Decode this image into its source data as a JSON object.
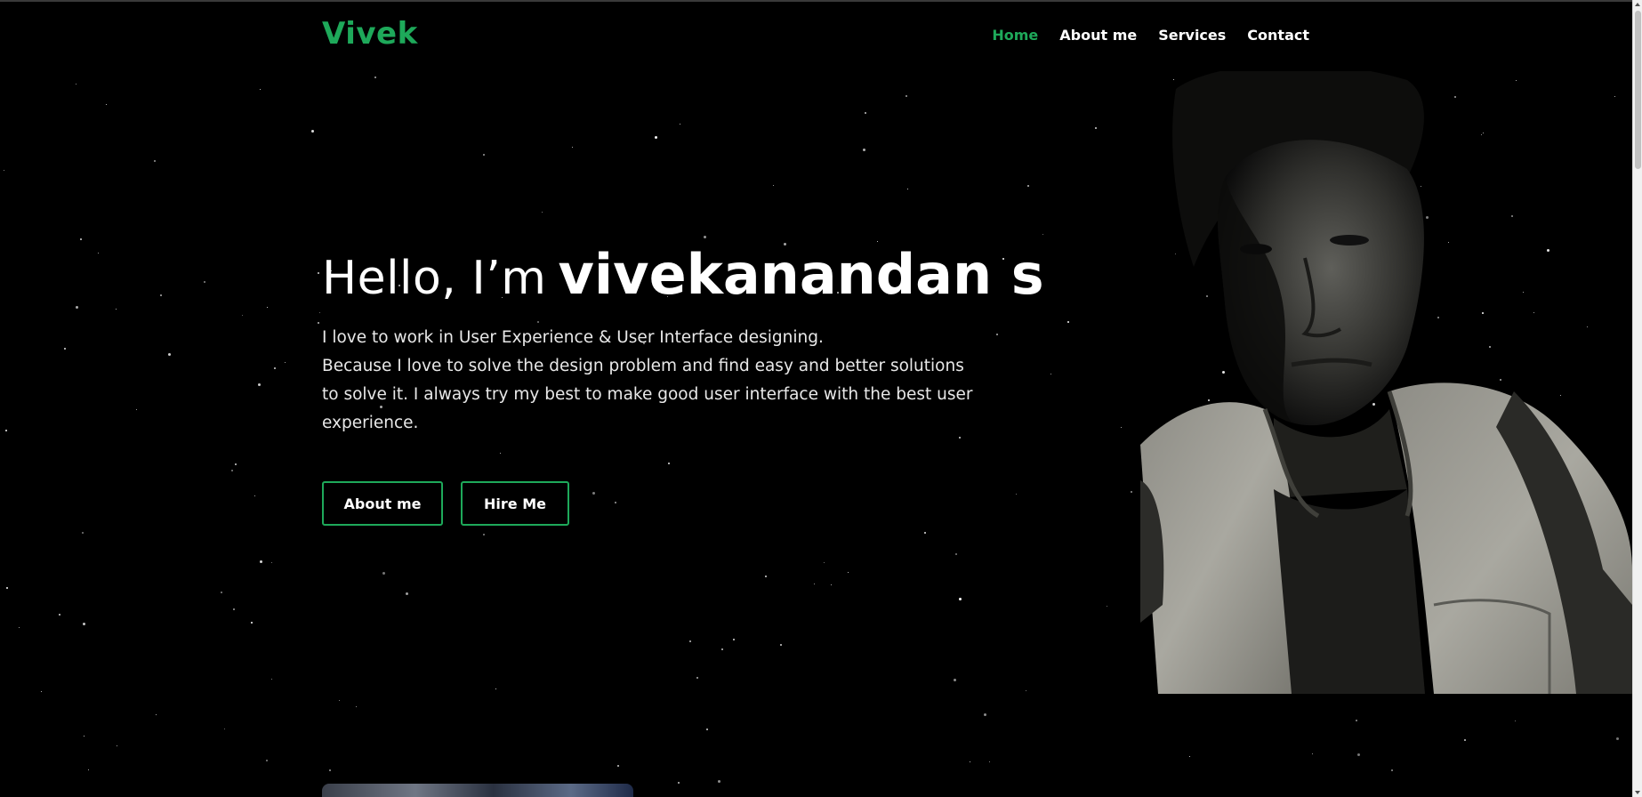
{
  "nav": {
    "logo": "Vivek",
    "links": [
      "Home",
      "About me",
      "Services",
      "Contact"
    ],
    "active_link": "Home"
  },
  "hero": {
    "greeting": "Hello, I’m",
    "name": "vivekanandan s",
    "description_line1": "I love to work in User Experience & User Interface designing.",
    "description_line2": "Because I love to solve the design problem and find easy and better solutions to solve it. I always try my best to make good user interface with the best user experience.",
    "buttons": {
      "about": "About me",
      "hire": "Hire Me"
    }
  },
  "colors": {
    "accent": "#1ea95a",
    "background": "#000000",
    "text": "#ffffff"
  },
  "portrait": {
    "icon": "profile-photo-icon"
  }
}
